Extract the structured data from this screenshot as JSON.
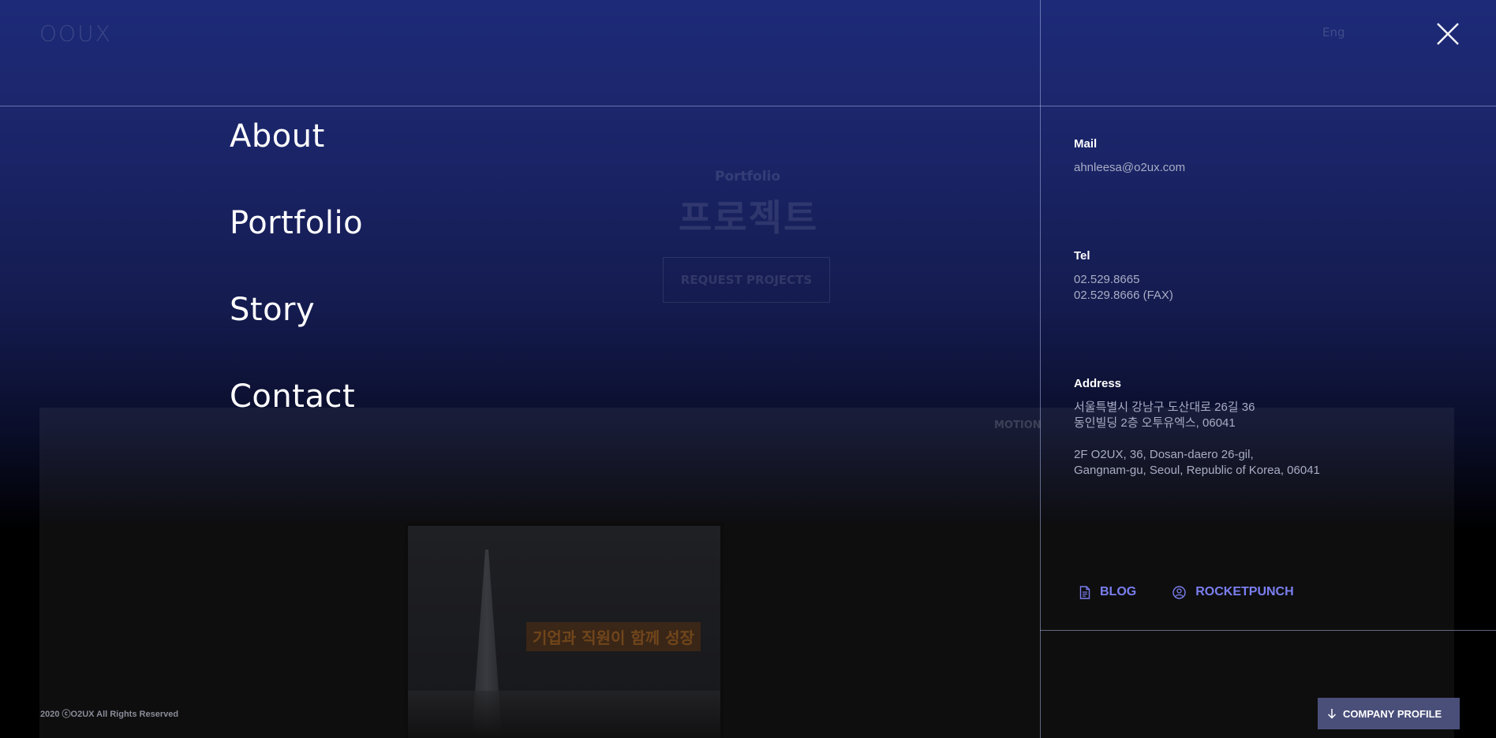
{
  "background": {
    "logo": "OOUX",
    "lang": "Eng",
    "section_label": "Portfolio",
    "section_title": "프로젝트",
    "request_button": "REQUEST PROJECTS",
    "active_filter": "MOTION",
    "card_headline": "기업과 직원이 함께 성장"
  },
  "menu": {
    "items": [
      {
        "label": "About"
      },
      {
        "label": "Portfolio"
      },
      {
        "label": "Story"
      },
      {
        "label": "Contact"
      }
    ]
  },
  "contact": {
    "mail_label": "Mail",
    "mail_value": "ahnleesa@o2ux.com",
    "tel_label": "Tel",
    "tel_value": "02.529.8665",
    "fax_value": "02.529.8666 (FAX)",
    "address_label": "Address",
    "address_kr_line1": "서울특별시 강남구 도산대로 26길 36",
    "address_kr_line2": "동인빌딩 2층 오투유엑스, 06041",
    "address_en_line1": "2F O2UX, 36, Dosan-daero 26-gil,",
    "address_en_line2": "Gangnam-gu, Seoul, Republic of Korea, 06041"
  },
  "links": {
    "blog": "BLOG",
    "rocketpunch": "ROCKETPUNCH"
  },
  "footer": {
    "copyright": "2020 ⓒO2UX All Rights Reserved",
    "company_profile": "COMPANY PROFILE"
  },
  "icons": {
    "close": "close-icon",
    "blog": "document-icon",
    "rocketpunch": "user-circle-icon",
    "download": "arrow-down-icon"
  },
  "colors": {
    "accent_link": "#7b7ff0",
    "menu_text": "#ffffff",
    "info_value": "#a9adc4",
    "profile_button": "#4a4f7a"
  }
}
